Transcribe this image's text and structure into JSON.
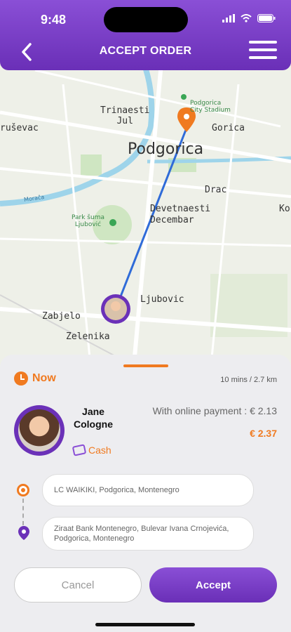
{
  "status_bar": {
    "time": "9:48"
  },
  "header": {
    "title": "ACCEPT ORDER",
    "back_icon": "back-arrow-icon",
    "menu_icon": "hamburger-menu-icon"
  },
  "map": {
    "labels": {
      "trinaesti_jul": "Trinaesti\nJul",
      "podgorica": "Podgorica",
      "gorica": "Gorica",
      "krusevac": "ruševac",
      "drac": "Drac",
      "devetnaesti": "Devetnaesti\nDecembar",
      "ko": "Ko",
      "ljubovic": "Ljubovic",
      "zabjelo": "Zabjelo",
      "zelenika": "Zelenika",
      "park": "Park šuma\nLjubović",
      "stadium": "Podgorica\nCity Stadium",
      "moraca": "Morača"
    },
    "route_color": "#2f6bd8",
    "pin_color": "#f07a20"
  },
  "sheet": {
    "now_label": "Now",
    "eta": "10 mins / 2.7 km",
    "driver": {
      "name": "Jane Cologne",
      "payment_method": "Cash"
    },
    "online_payment_label": "With online payment : € 2.13",
    "price": "€ 2.37",
    "pickup": "LC WAIKIKI, Podgorica, Montenegro",
    "dropoff": "Ziraat Bank Montenegro, Bulevar Ivana Crnojevića, Podgorica, Montenegro",
    "cancel_label": "Cancel",
    "accept_label": "Accept"
  },
  "colors": {
    "brand_purple": "#6a2fb7",
    "accent_orange": "#f07a20"
  }
}
